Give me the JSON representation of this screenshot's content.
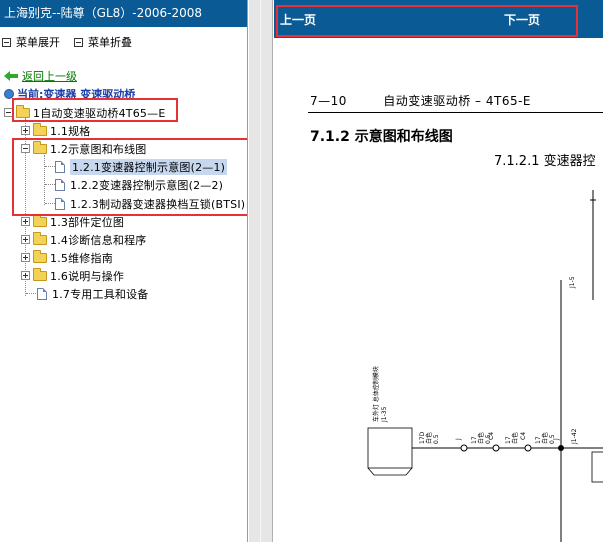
{
  "window": {
    "title": "上海别克--陆尊（GL8）-2006-2008"
  },
  "menu": {
    "expand_label": "菜单展开",
    "collapse_label": "菜单折叠"
  },
  "nav": {
    "back_label": "返回上一级",
    "current_path": "当前:变速器 变速驱动桥"
  },
  "tree": {
    "root": "1自动变速驱动桥4T65—E",
    "items": [
      {
        "label": "1.1规格"
      },
      {
        "label": "1.2示意图和布线图"
      },
      {
        "label": "1.2.1变速器控制示意图(2—1)"
      },
      {
        "label": "1.2.2变速器控制示意图(2—2)"
      },
      {
        "label": "1.2.3制动器变速器换档互锁(BTSI)"
      },
      {
        "label": "1.3部件定位图"
      },
      {
        "label": "1.4诊断信息和程序"
      },
      {
        "label": "1.5维修指南"
      },
      {
        "label": "1.6说明与操作"
      },
      {
        "label": "1.7专用工具和设备"
      }
    ]
  },
  "doc_nav": {
    "prev_label": "上一页",
    "next_label": "下一页"
  },
  "document": {
    "page_number": "7—10",
    "chapter": "自动变速驱动桥 – 4T65-E",
    "section_title": "7.1.2 示意图和布线图",
    "subsection_title": "7.1.2.1 变速器控",
    "schematic": {
      "left_block_label": "车外灯\n总体控制模块",
      "left_block_pin": "J1-35",
      "top_pin": "J1-5",
      "mid_pin": "J1-42",
      "wires": [
        {
          "num": "17D",
          "color": "白色",
          "gauge": "0.5"
        },
        {
          "num": "17",
          "color": "白色",
          "gauge": "0.5"
        },
        {
          "num": "17",
          "color": "白色",
          "gauge": "0.5"
        },
        {
          "num": "17",
          "color": "白色",
          "gauge": "0.5"
        }
      ],
      "connectors": [
        "J",
        "C4",
        "C4",
        "J"
      ]
    }
  },
  "colors": {
    "title_bar": "#0a5a96",
    "highlight": "#e43236",
    "selected": "#c7d8ee",
    "link": "#007a00"
  }
}
